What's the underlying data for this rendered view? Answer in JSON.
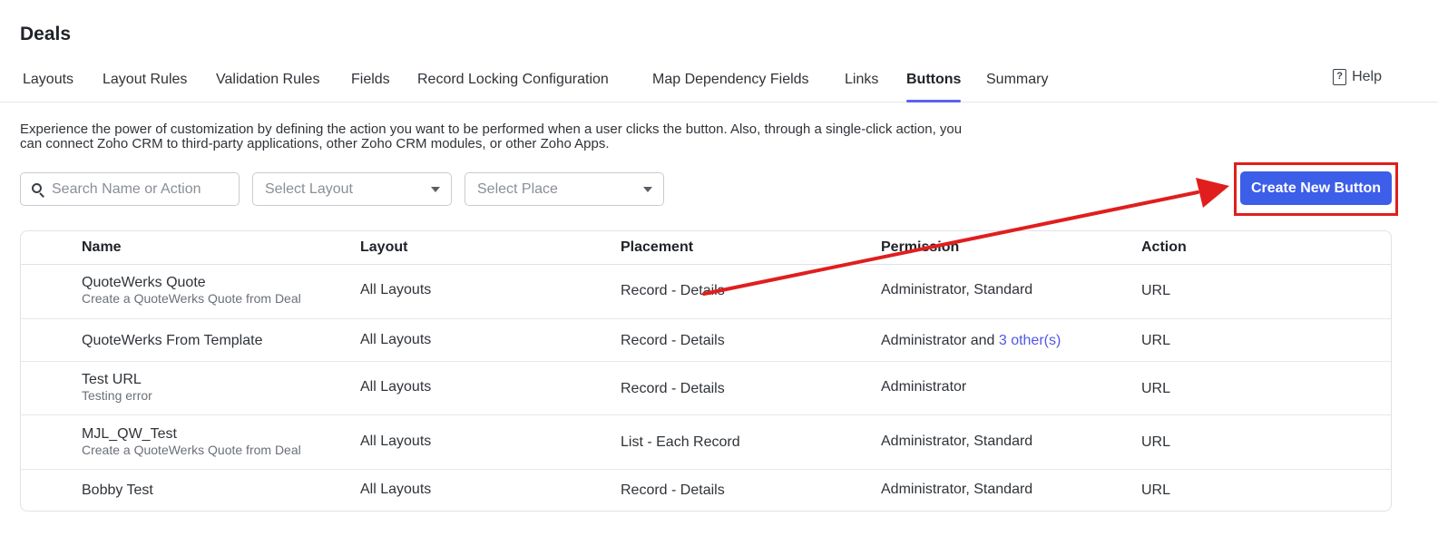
{
  "page": {
    "title": "Deals"
  },
  "tabs": [
    {
      "label": "Layouts"
    },
    {
      "label": "Layout Rules"
    },
    {
      "label": "Validation Rules"
    },
    {
      "label": "Fields"
    },
    {
      "label": "Record Locking Configuration"
    },
    {
      "label": "Map Dependency Fields"
    },
    {
      "label": "Links"
    },
    {
      "label": "Buttons",
      "active": true
    },
    {
      "label": "Summary"
    }
  ],
  "help": {
    "label": "Help"
  },
  "description": "Experience the power of customization by defining the action you want to be performed when a user clicks the button. Also, through a single-click action, you can connect Zoho CRM to third-party applications, other Zoho CRM modules, or other Zoho Apps.",
  "filters": {
    "search_placeholder": "Search Name or Action",
    "layout_placeholder": "Select Layout",
    "place_placeholder": "Select Place"
  },
  "create_button": {
    "label": "Create New Button"
  },
  "table": {
    "columns": [
      "Name",
      "Layout",
      "Placement",
      "Permission",
      "Action"
    ],
    "rows": [
      {
        "name": "QuoteWerks Quote",
        "description": "Create a QuoteWerks Quote from Deal",
        "layout": "All Layouts",
        "placement": "Record - Details",
        "permission": "Administrator, Standard",
        "permission_link": "",
        "action": "URL"
      },
      {
        "name": "QuoteWerks From Template",
        "description": "",
        "layout": "All Layouts",
        "placement": "Record - Details",
        "permission": "Administrator and ",
        "permission_link": "3 other(s)",
        "action": "URL"
      },
      {
        "name": "Test URL",
        "description": "Testing error",
        "layout": "All Layouts",
        "placement": "Record - Details",
        "permission": "Administrator",
        "permission_link": "",
        "action": "URL"
      },
      {
        "name": "MJL_QW_Test",
        "description": "Create a QuoteWerks Quote from Deal",
        "layout": "All Layouts",
        "placement": "List - Each Record",
        "permission": "Administrator, Standard",
        "permission_link": "",
        "action": "URL"
      },
      {
        "name": "Bobby Test",
        "description": "",
        "layout": "All Layouts",
        "placement": "Record - Details",
        "permission": "Administrator, Standard",
        "permission_link": "",
        "action": "URL"
      }
    ]
  },
  "colors": {
    "accent": "#3c5ee8",
    "annotation": "#e01e1e",
    "link": "#4f57e8"
  }
}
